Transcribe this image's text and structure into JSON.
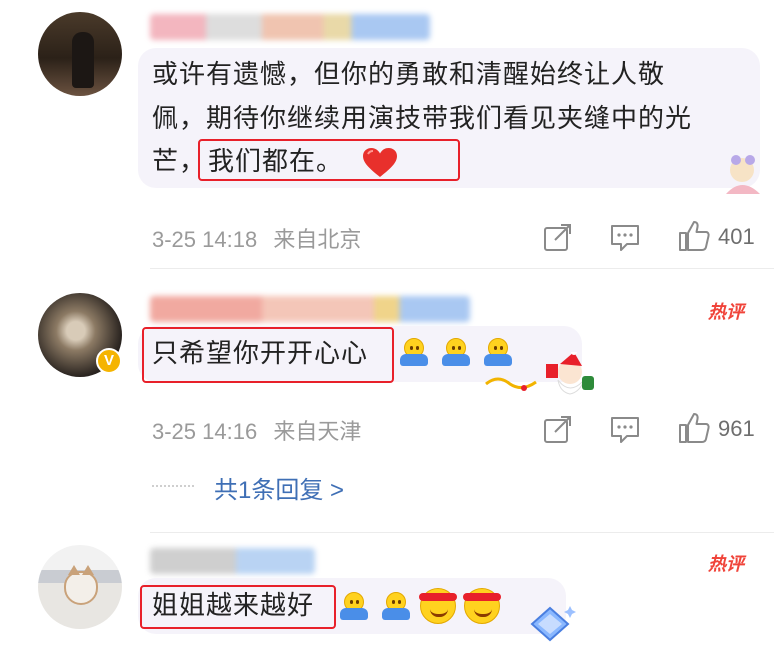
{
  "comments": [
    {
      "text_line1": "或许有遗憾，但你的勇敢和清醒始终让人敬",
      "text_line2": "佩，期待你继续用演技带我们看见夹缝中的光",
      "text_line3_prefix": "芒，",
      "text_highlight": "我们都在。",
      "timestamp": "3-25 14:18",
      "location": "来自北京",
      "like_count": "401"
    },
    {
      "text": "只希望你开开心心",
      "badge": "热评",
      "verified_badge": "V",
      "timestamp": "3-25 14:16",
      "location": "来自天津",
      "like_count": "961",
      "replies_link": "共1条回复 >"
    },
    {
      "text": "姐姐越来越好",
      "badge": "热评"
    }
  ],
  "colors": {
    "highlight_box": "#e8202a",
    "hot_badge": "#f0443a",
    "link": "#3f6fb5",
    "meta": "#9a9a9a"
  },
  "icons": [
    "share-icon",
    "comment-icon",
    "like-icon",
    "heart-emoji",
    "hug-emoji",
    "smile-emoji",
    "santa-sticker"
  ]
}
